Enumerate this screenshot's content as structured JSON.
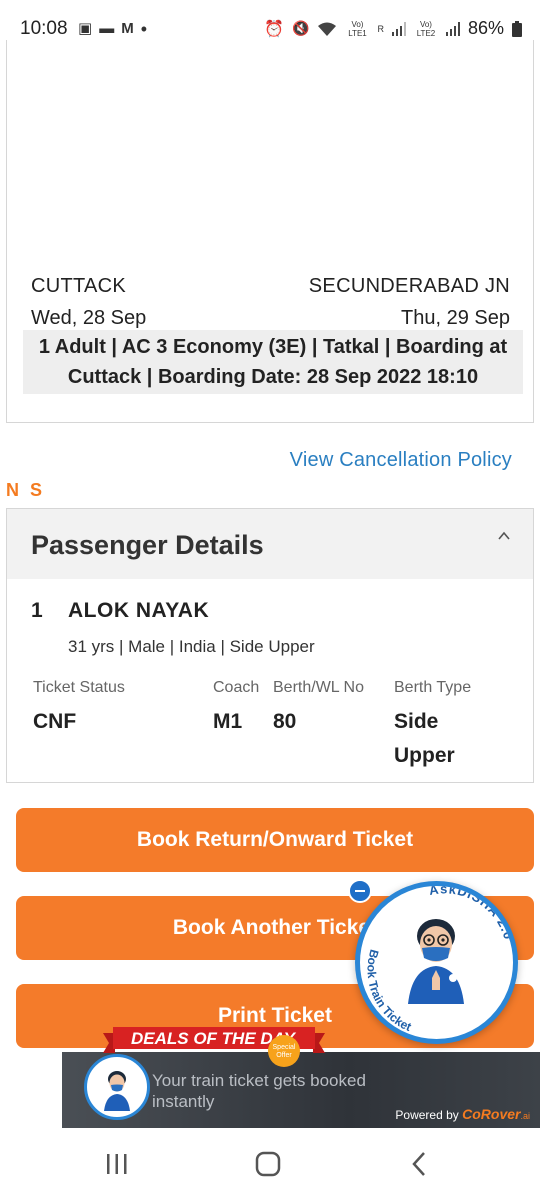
{
  "status_bar": {
    "time": "10:08",
    "battery": "86%",
    "sim1_label": "Vo) LTE1",
    "sim2_label": "Vo) LTE2",
    "signal_r": "R"
  },
  "journey": {
    "from_station": "CUTTACK",
    "to_station": "SECUNDERABAD JN",
    "from_date": "Wed, 28 Sep",
    "to_date": "Thu, 29 Sep",
    "info_line1": "1 Adult | AC 3 Economy (3E) | Tatkal | Boarding at",
    "info_line2": "Cuttack | Boarding Date: 28 Sep 2022 18:10"
  },
  "cancellation_link": "View Cancellation Policy",
  "ns_label": "N S",
  "passenger_section": {
    "title": "Passenger Details",
    "passenger": {
      "index": "1",
      "name": "ALOK NAYAK",
      "meta": "31 yrs | Male | India | Side Upper"
    },
    "labels": {
      "ticket_status": "Ticket Status",
      "coach": "Coach",
      "berth_wl": "Berth/WL No",
      "berth_type": "Berth Type"
    },
    "values": {
      "ticket_status": "CNF",
      "coach": "M1",
      "berth_wl": "80",
      "berth_type_line1": "Side",
      "berth_type_line2": "Upper"
    }
  },
  "buttons": {
    "book_return": "Book Return/Onward Ticket",
    "book_another": "Book Another Ticket",
    "print": "Print Ticket"
  },
  "disha_widget": {
    "brand": "AskDISHA 2.0",
    "tagline": "Book Train Ticket"
  },
  "deals_banner": {
    "ribbon": "DEALS OF THE DAY",
    "badge_line1": "Special",
    "badge_line2": "Offer",
    "text_line1": "Your train ticket gets booked",
    "text_line2": "instantly",
    "powered_by": "Powered by",
    "powered_brand": "CoRover",
    "powered_suffix": ".ai"
  },
  "colors": {
    "accent_orange": "#f47b2a",
    "link_blue": "#2a7fc1",
    "disha_blue": "#2a86d6"
  }
}
